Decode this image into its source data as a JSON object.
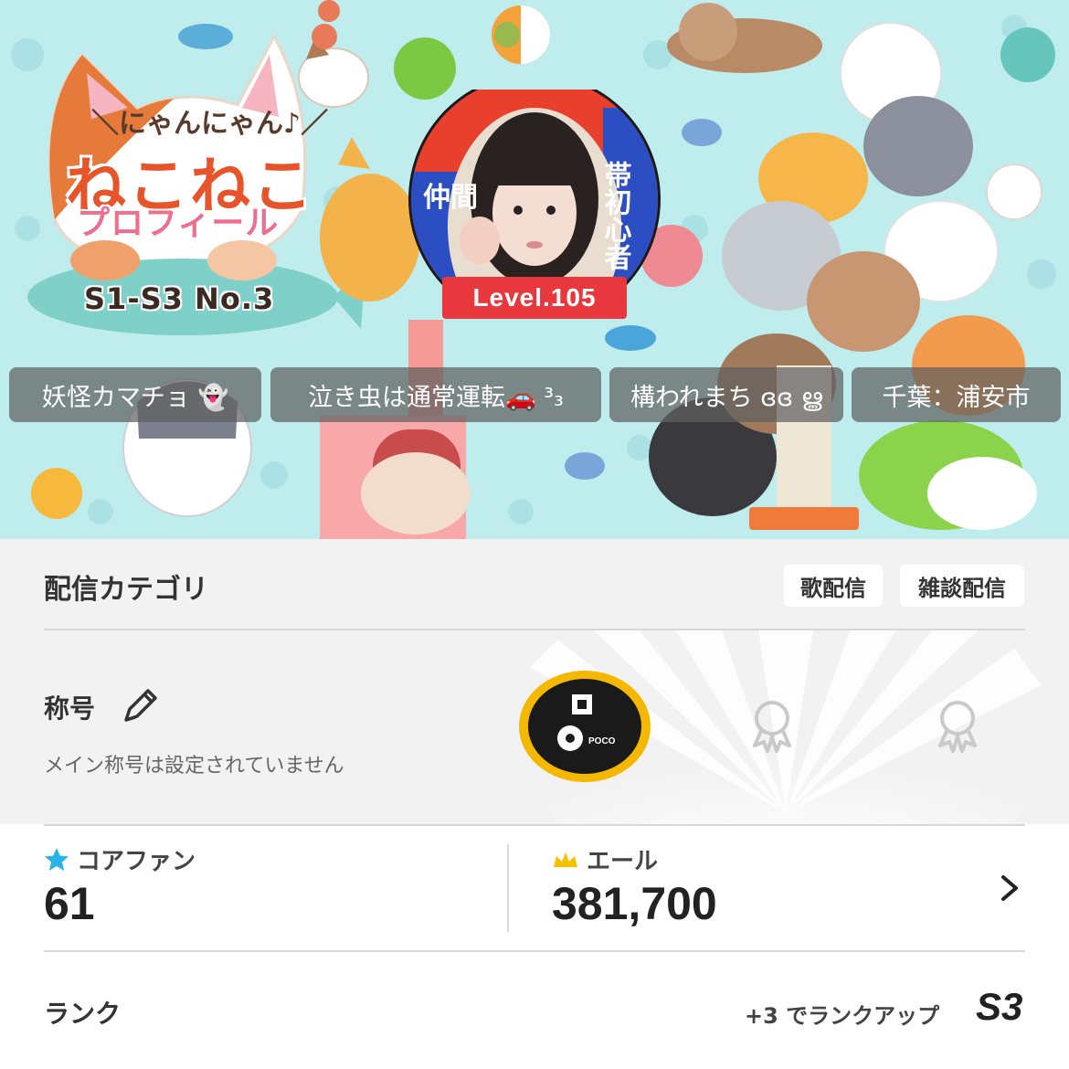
{
  "banner": {
    "subtitle": "＼にゃんにゃん♪／",
    "title": "ねこねこ",
    "subtitle2": "プロフィール",
    "rank_text": "S1-S3  No.3",
    "avatar_side_left": "仲間",
    "avatar_side_right": "帯初心者",
    "level": "Level.105"
  },
  "tags": [
    "妖怪カマチョ 👻",
    "泣き虫は通常運転🚗 ³₃",
    "構われまち ɞɞ ൠ",
    "千葉：浦安市"
  ],
  "category": {
    "title": "配信カテゴリ",
    "chips": [
      "歌配信",
      "雑談配信"
    ]
  },
  "title_section": {
    "label": "称号",
    "note": "メイン称号は設定されていません",
    "medal_text": "POCO"
  },
  "stats": {
    "core_fan_label": "コアファン",
    "core_fan_value": "61",
    "yell_label": "エール",
    "yell_value": "381,700"
  },
  "rank": {
    "label": "ランク",
    "hint": "+3 でランクアップ",
    "value": "S3"
  },
  "colors": {
    "hero_bg": "#bfecec",
    "level_badge": "#e8373d",
    "medal_gold": "#f5b800",
    "star_blue": "#2ab3e8"
  }
}
